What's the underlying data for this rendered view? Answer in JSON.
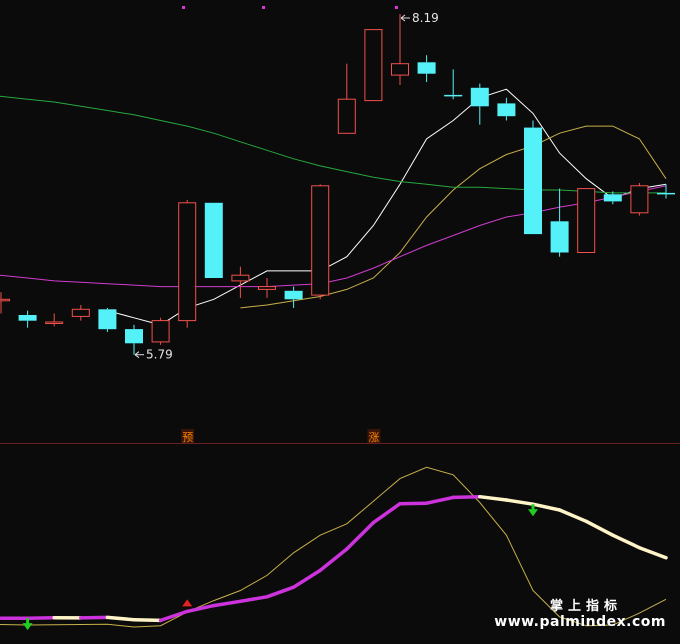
{
  "chart_data": [
    {
      "type": "candlestick",
      "price_range": [
        5.33,
        8.19
      ],
      "candles": [
        {
          "o": 6.18,
          "h": 6.23,
          "l": 6.08,
          "c": 6.18
        },
        {
          "o": 6.07,
          "h": 6.1,
          "l": 5.98,
          "c": 6.03
        },
        {
          "o": 6.02,
          "h": 6.08,
          "l": 5.99,
          "c": 6.02
        },
        {
          "o": 6.06,
          "h": 6.14,
          "l": 6.03,
          "c": 6.11
        },
        {
          "o": 6.11,
          "h": 6.12,
          "l": 5.95,
          "c": 5.97
        },
        {
          "o": 5.97,
          "h": 6.0,
          "l": 5.79,
          "c": 5.87
        },
        {
          "o": 5.88,
          "h": 6.05,
          "l": 5.86,
          "c": 6.03
        },
        {
          "o": 6.03,
          "h": 6.88,
          "l": 5.98,
          "c": 6.86
        },
        {
          "o": 6.86,
          "h": 6.86,
          "l": 6.33,
          "c": 6.33
        },
        {
          "o": 6.31,
          "h": 6.41,
          "l": 6.19,
          "c": 6.35
        },
        {
          "o": 6.25,
          "h": 6.33,
          "l": 6.19,
          "c": 6.27
        },
        {
          "o": 6.24,
          "h": 6.27,
          "l": 6.12,
          "c": 6.18
        },
        {
          "o": 6.21,
          "h": 6.99,
          "l": 6.18,
          "c": 6.98
        },
        {
          "o": 7.35,
          "h": 7.84,
          "l": 7.35,
          "c": 7.59
        },
        {
          "o": 7.58,
          "h": 8.08,
          "l": 7.58,
          "c": 8.08
        },
        {
          "o": 7.76,
          "h": 8.19,
          "l": 7.69,
          "c": 7.84
        },
        {
          "o": 7.85,
          "h": 7.9,
          "l": 7.71,
          "c": 7.77
        },
        {
          "o": 7.62,
          "h": 7.8,
          "l": 7.59,
          "c": 7.61
        },
        {
          "o": 7.67,
          "h": 7.7,
          "l": 7.41,
          "c": 7.54
        },
        {
          "o": 7.56,
          "h": 7.6,
          "l": 7.44,
          "c": 7.47
        },
        {
          "o": 7.39,
          "h": 7.44,
          "l": 6.64,
          "c": 6.64
        },
        {
          "o": 6.73,
          "h": 6.96,
          "l": 6.48,
          "c": 6.51
        },
        {
          "o": 6.51,
          "h": 6.96,
          "l": 6.51,
          "c": 6.96
        },
        {
          "o": 6.92,
          "h": 6.94,
          "l": 6.85,
          "c": 6.87
        },
        {
          "o": 6.79,
          "h": 7.0,
          "l": 6.77,
          "c": 6.98
        },
        {
          "o": 6.93,
          "h": 6.99,
          "l": 6.89,
          "c": 6.92
        }
      ],
      "ma_lines": [
        {
          "name": "",
          "color": "#ffffff",
          "values": [
            null,
            null,
            null,
            null,
            6.1,
            6.05,
            6.0,
            6.12,
            6.18,
            6.28,
            6.38,
            6.38,
            6.38,
            6.48,
            6.7,
            6.99,
            7.31,
            7.44,
            7.6,
            7.66,
            7.49,
            7.21,
            7.03,
            6.89,
            6.96,
            6.99
          ]
        },
        {
          "name": "",
          "color": "#c8b04a",
          "values": [
            null,
            null,
            null,
            null,
            null,
            null,
            null,
            null,
            null,
            6.12,
            6.14,
            6.17,
            6.2,
            6.25,
            6.33,
            6.51,
            6.76,
            6.95,
            7.1,
            7.2,
            7.26,
            7.35,
            7.4,
            7.4,
            7.31,
            7.03
          ]
        },
        {
          "name": "",
          "color": "#d13cd1",
          "values": [
            6.35,
            6.33,
            6.31,
            6.3,
            6.29,
            6.28,
            6.27,
            6.27,
            6.27,
            6.27,
            6.27,
            6.28,
            6.29,
            6.33,
            6.4,
            6.48,
            6.56,
            6.63,
            6.7,
            6.76,
            6.79,
            6.83,
            6.86,
            6.9,
            6.94,
            6.98
          ]
        },
        {
          "name": "",
          "color": "#27a83f",
          "values": [
            7.61,
            7.59,
            7.57,
            7.54,
            7.51,
            7.48,
            7.44,
            7.4,
            7.35,
            7.29,
            7.23,
            7.17,
            7.12,
            7.08,
            7.04,
            7.01,
            6.99,
            6.97,
            6.97,
            6.96,
            6.95,
            6.95,
            6.94,
            6.93,
            6.93,
            6.93
          ]
        }
      ],
      "annotations": [
        {
          "text": "8.19",
          "candle": 15,
          "price": 8.19
        },
        {
          "text": "5.79",
          "candle": 5,
          "price": 5.79
        }
      ],
      "signals": [
        {
          "text": "预",
          "candle": 7,
          "color": "#ff8800"
        },
        {
          "text": "涨",
          "candle": 14,
          "color": "#ff8800"
        }
      ]
    },
    {
      "type": "line",
      "series": [
        {
          "name": "",
          "color": "#c8b04a",
          "values": [
            0.3,
            0.28,
            0.29,
            0.3,
            0.31,
            0.2,
            0.25,
            0.8,
            1.25,
            1.65,
            2.25,
            3.15,
            3.85,
            4.3,
            5.2,
            6.1,
            6.55,
            6.25,
            5.15,
            3.85,
            1.65,
            0.6,
            0.25,
            0.28,
            0.75,
            1.3
          ]
        },
        {
          "name": "",
          "color": "#d43ee0",
          "values": [
            0.55,
            0.55,
            0.57,
            0.56,
            0.58,
            0.49,
            0.46,
            0.82,
            1.05,
            1.22,
            1.4,
            1.78,
            2.45,
            3.3,
            4.35,
            5.1,
            5.12,
            5.35,
            5.38,
            5.25,
            5.08,
            4.85,
            4.4,
            3.85,
            3.35,
            2.95
          ]
        }
      ],
      "signals": [
        {
          "type": "down-arrow",
          "index": 1,
          "color": "#22cc22"
        },
        {
          "type": "up-arrow",
          "index": 7,
          "color": "#e02222"
        },
        {
          "type": "down-arrow",
          "index": 20,
          "color": "#22cc22"
        }
      ]
    }
  ],
  "watermark": {
    "cn": "掌上指标",
    "url": "www.palmindex.com"
  },
  "colors": {
    "up": "#f2504a",
    "down": "#54f2f8",
    "background": "#0b0b0b",
    "divider": "#6a2020"
  }
}
